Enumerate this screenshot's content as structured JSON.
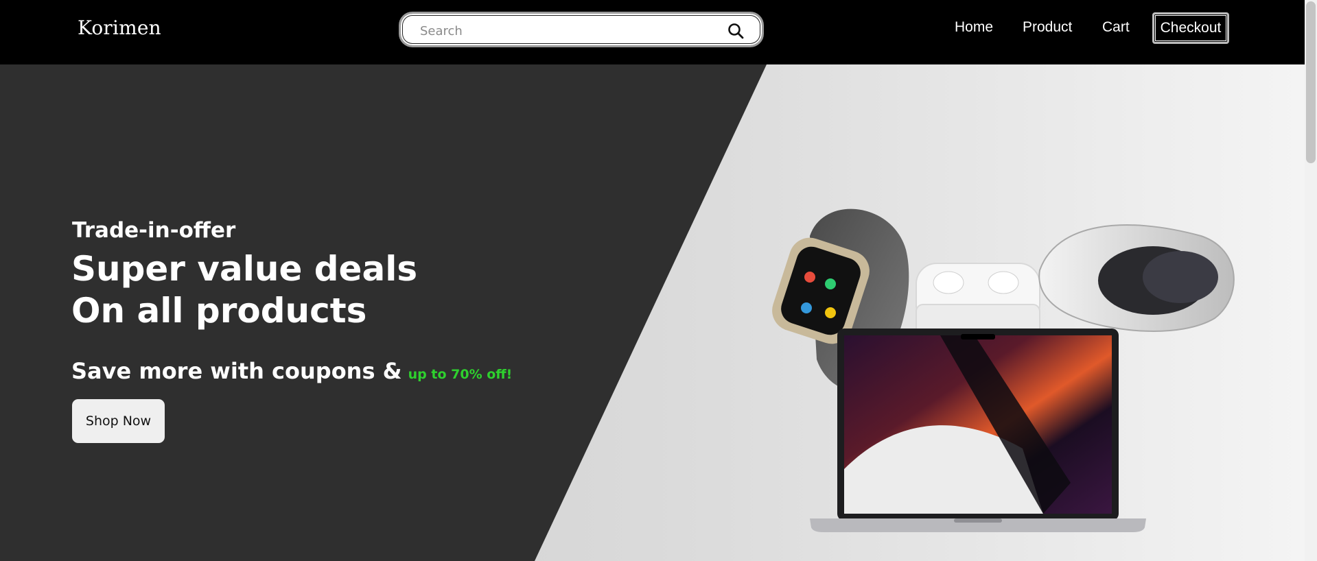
{
  "navbar": {
    "brand": "Korimen",
    "search": {
      "placeholder": "Search",
      "value": ""
    },
    "links": {
      "home": "Home",
      "product": "Product",
      "cart": "Cart",
      "checkout": "Checkout"
    }
  },
  "hero": {
    "tagline": "Trade-in-offer",
    "headline_line1": "Super value deals",
    "headline_line2": "On all products",
    "coupon_text": "Save more with coupons &",
    "coupon_highlight": "up to 70% off!",
    "cta_label": "Shop Now",
    "product_image": "apple-watch, airpods, vr-headset, laptop"
  },
  "colors": {
    "navbar_bg": "#000000",
    "hero_dark": "#2f2f2f",
    "highlight_green": "#2ed12e",
    "button_bg": "#efefef"
  },
  "icons": {
    "search": "search-icon"
  }
}
